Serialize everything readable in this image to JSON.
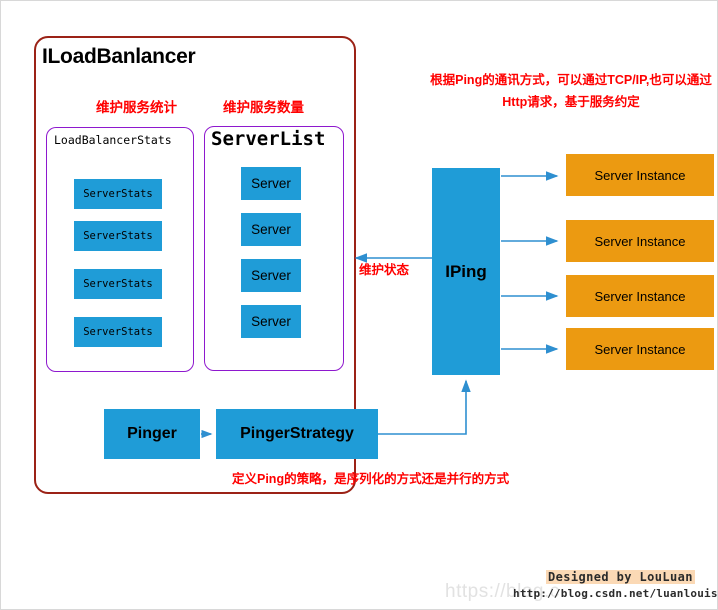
{
  "diagram": {
    "title": "ILoadBanlancer",
    "outer_border_color": "#9B2216",
    "sub_border_color": "#8E18CE",
    "blue": "#1F9CD7",
    "orange": "#EC9A11",
    "red": "#FF0000"
  },
  "labels": {
    "maintain_stats": "维护服务统计",
    "maintain_count": "维护服务数量",
    "maintain_state": "维护状态",
    "ping_note": "根据Ping的通讯方式，可以通过TCP/IP,也可以通过Http请求，基于服务约定",
    "strategy_note": "定义Ping的策略，是序列化的方式还是并行的方式"
  },
  "load_balancer_stats": {
    "title": "LoadBalancerStats",
    "items": [
      {
        "label": "ServerStats"
      },
      {
        "label": "ServerStats"
      },
      {
        "label": "ServerStats"
      },
      {
        "label": "ServerStats"
      }
    ]
  },
  "server_list": {
    "title": "ServerList",
    "items": [
      {
        "label": "Server"
      },
      {
        "label": "Server"
      },
      {
        "label": "Server"
      },
      {
        "label": "Server"
      }
    ]
  },
  "iping": {
    "label": "IPing"
  },
  "server_instances": [
    {
      "label": "Server Instance"
    },
    {
      "label": "Server Instance"
    },
    {
      "label": "Server Instance"
    },
    {
      "label": "Server Instance"
    }
  ],
  "pinger": {
    "label": "Pinger"
  },
  "pinger_strategy": {
    "label": "PingerStrategy"
  },
  "footer": {
    "signature": "Designed by LouLuan",
    "url": "http://blog.csdn.net/luanlouis",
    "watermark": "https://blog.c"
  }
}
